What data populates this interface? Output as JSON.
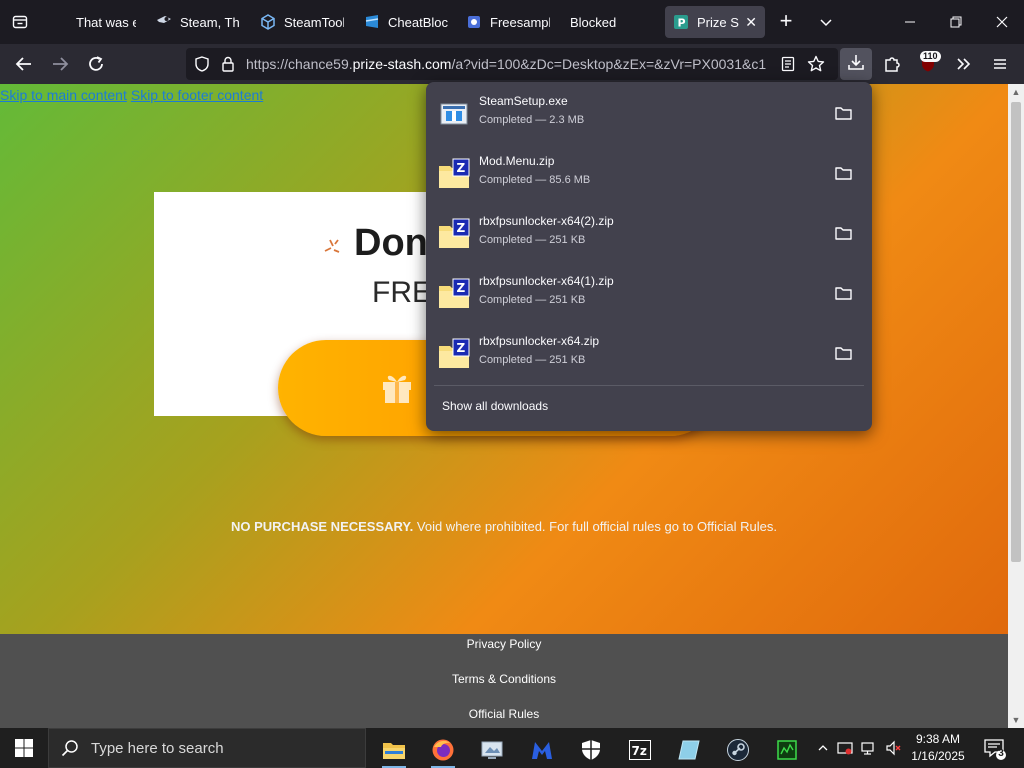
{
  "tabs": [
    {
      "label": "That was e",
      "icon": "none"
    },
    {
      "label": "Steam, The",
      "icon": "steam-icon"
    },
    {
      "label": "SteamTools",
      "icon": "cube-icon"
    },
    {
      "label": "CheatBlock",
      "icon": "cheatblock-icon"
    },
    {
      "label": "Freesample",
      "icon": "freesample-icon"
    },
    {
      "label": "Blocked",
      "icon": "none"
    },
    {
      "label": "Prize Sta",
      "icon": "prize-icon",
      "active": true
    }
  ],
  "nav": {
    "url_prefix": "https://chance59.",
    "url_domain": "prize-stash.com",
    "url_rest": "/a?vid=100&zDc=Desktop&zEx=&zVr=PX0031&c1",
    "extensions_badge": "110"
  },
  "page": {
    "skip_links": [
      "Skip to main content",
      "Skip to footer content"
    ],
    "card_title": "Don",
    "card_subtitle": "FREE",
    "disclaimer_bold": "NO PURCHASE NECESSARY.",
    "disclaimer_rest": " Void where prohibited. For full official rules go to Official Rules.",
    "footer_links": [
      "Privacy Policy",
      "Terms & Conditions",
      "Official Rules"
    ]
  },
  "downloads": {
    "items": [
      {
        "name": "SteamSetup.exe",
        "status": "Completed — 2.3 MB",
        "icon": "exe-icon"
      },
      {
        "name": "Mod.Menu.zip",
        "status": "Completed — 85.6 MB",
        "icon": "zip-icon"
      },
      {
        "name": "rbxfpsunlocker-x64(2).zip",
        "status": "Completed — 251 KB",
        "icon": "zip-icon"
      },
      {
        "name": "rbxfpsunlocker-x64(1).zip",
        "status": "Completed — 251 KB",
        "icon": "zip-icon"
      },
      {
        "name": "rbxfpsunlocker-x64.zip",
        "status": "Completed — 251 KB",
        "icon": "zip-icon"
      }
    ],
    "show_all": "Show all downloads"
  },
  "taskbar": {
    "search_placeholder": "Type here to search",
    "time": "9:38 AM",
    "date": "1/16/2025",
    "notification_count": "3",
    "accent": "#7eb6e6"
  }
}
